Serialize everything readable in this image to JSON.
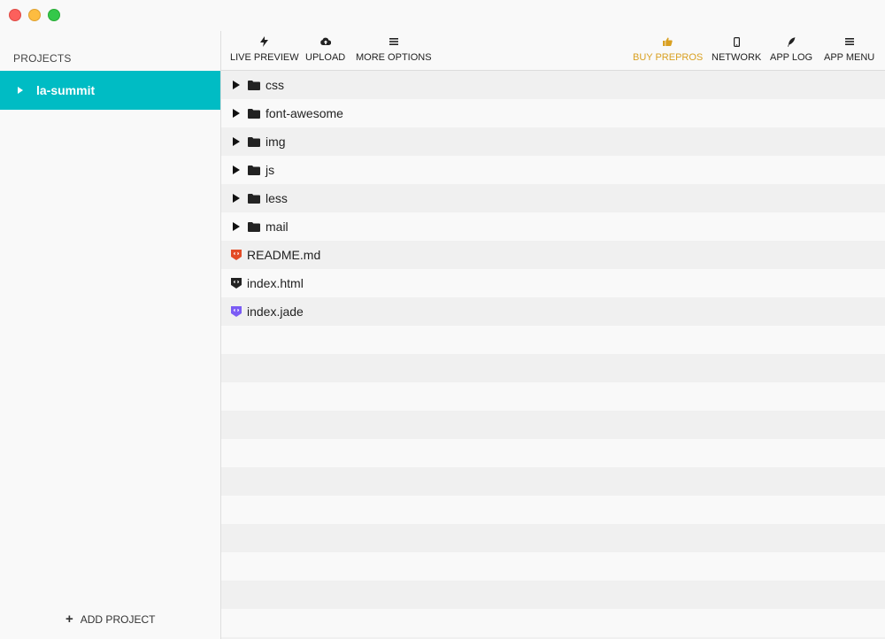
{
  "sidebar": {
    "heading": "PROJECTS",
    "projects": [
      {
        "name": "la-summit",
        "selected": true
      }
    ],
    "add_project_label": "ADD PROJECT"
  },
  "toolbar": {
    "live_preview": "LIVE PREVIEW",
    "upload": "UPLOAD",
    "more_options": "MORE OPTIONS",
    "buy_prepros": "BUY PREPROS",
    "network": "NETWORK",
    "app_log": "APP LOG",
    "app_menu": "APP MENU"
  },
  "files": {
    "folders": [
      "css",
      "font-awesome",
      "img",
      "js",
      "less",
      "mail"
    ],
    "documents": [
      {
        "name": "README.md",
        "icon": "markdown-file-icon",
        "color": "#e34c26"
      },
      {
        "name": "index.html",
        "icon": "html-file-icon",
        "color": "#222222"
      },
      {
        "name": "index.jade",
        "icon": "jade-file-icon",
        "color": "#7b5cf5"
      }
    ]
  },
  "colors": {
    "accent": "#00bcc4",
    "buy": "#d9a021"
  }
}
